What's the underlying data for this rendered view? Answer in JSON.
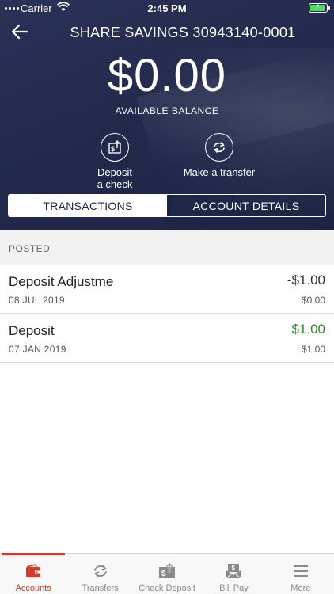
{
  "status_bar": {
    "carrier": "Carrier",
    "time": "2:45 PM"
  },
  "header": {
    "title": "SHARE SAVINGS 30943140-0001",
    "back_icon": "arrow-left-icon"
  },
  "balance": {
    "amount": "$0.00",
    "label": "AVAILABLE BALANCE"
  },
  "actions": [
    {
      "label_line1": "Deposit",
      "label_line2": "a check",
      "icon": "check-deposit-icon"
    },
    {
      "label": "Make a transfer",
      "icon": "transfer-icon"
    }
  ],
  "segments": {
    "active": "TRANSACTIONS",
    "inactive": "ACCOUNT DETAILS"
  },
  "section": {
    "label": "POSTED"
  },
  "transactions": [
    {
      "name": "Deposit Adjustme",
      "date": "08 JUL 2019",
      "amount": "-$1.00",
      "balance": "$0.00",
      "amount_color": "#333333"
    },
    {
      "name": "Deposit",
      "date": "07 JAN 2019",
      "amount": "$1.00",
      "balance": "$1.00",
      "amount_color": "#2e8b2e"
    }
  ],
  "tabbar": {
    "items": [
      {
        "label": "Accounts",
        "icon": "wallet-icon",
        "active": true
      },
      {
        "label": "Transfers",
        "icon": "transfer-icon"
      },
      {
        "label": "Check Deposit",
        "icon": "check-deposit-icon"
      },
      {
        "label": "Bill Pay",
        "icon": "bill-pay-icon"
      },
      {
        "label": "More",
        "icon": "menu-icon"
      }
    ]
  },
  "colors": {
    "hero_bg": "#232a4d",
    "accent": "#d63a2a",
    "positive": "#2e8b2e",
    "battery": "#4cd964"
  }
}
